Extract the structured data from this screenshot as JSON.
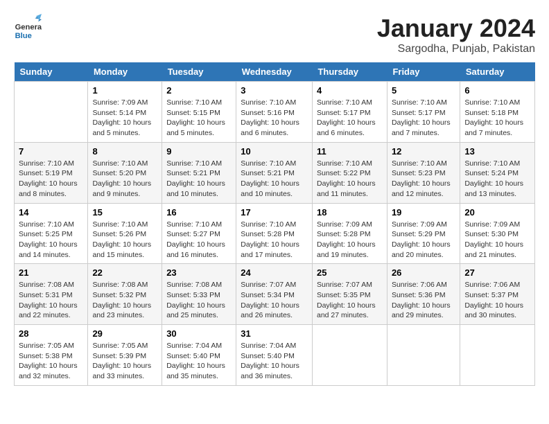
{
  "header": {
    "logo": {
      "general": "General",
      "blue": "Blue"
    },
    "title": "January 2024",
    "location": "Sargodha, Punjab, Pakistan"
  },
  "weekdays": [
    "Sunday",
    "Monday",
    "Tuesday",
    "Wednesday",
    "Thursday",
    "Friday",
    "Saturday"
  ],
  "weeks": [
    [
      {
        "day": "",
        "info": ""
      },
      {
        "day": "1",
        "info": "Sunrise: 7:09 AM\nSunset: 5:14 PM\nDaylight: 10 hours\nand 5 minutes."
      },
      {
        "day": "2",
        "info": "Sunrise: 7:10 AM\nSunset: 5:15 PM\nDaylight: 10 hours\nand 5 minutes."
      },
      {
        "day": "3",
        "info": "Sunrise: 7:10 AM\nSunset: 5:16 PM\nDaylight: 10 hours\nand 6 minutes."
      },
      {
        "day": "4",
        "info": "Sunrise: 7:10 AM\nSunset: 5:17 PM\nDaylight: 10 hours\nand 6 minutes."
      },
      {
        "day": "5",
        "info": "Sunrise: 7:10 AM\nSunset: 5:17 PM\nDaylight: 10 hours\nand 7 minutes."
      },
      {
        "day": "6",
        "info": "Sunrise: 7:10 AM\nSunset: 5:18 PM\nDaylight: 10 hours\nand 7 minutes."
      }
    ],
    [
      {
        "day": "7",
        "info": "Sunrise: 7:10 AM\nSunset: 5:19 PM\nDaylight: 10 hours\nand 8 minutes."
      },
      {
        "day": "8",
        "info": "Sunrise: 7:10 AM\nSunset: 5:20 PM\nDaylight: 10 hours\nand 9 minutes."
      },
      {
        "day": "9",
        "info": "Sunrise: 7:10 AM\nSunset: 5:21 PM\nDaylight: 10 hours\nand 10 minutes."
      },
      {
        "day": "10",
        "info": "Sunrise: 7:10 AM\nSunset: 5:21 PM\nDaylight: 10 hours\nand 10 minutes."
      },
      {
        "day": "11",
        "info": "Sunrise: 7:10 AM\nSunset: 5:22 PM\nDaylight: 10 hours\nand 11 minutes."
      },
      {
        "day": "12",
        "info": "Sunrise: 7:10 AM\nSunset: 5:23 PM\nDaylight: 10 hours\nand 12 minutes."
      },
      {
        "day": "13",
        "info": "Sunrise: 7:10 AM\nSunset: 5:24 PM\nDaylight: 10 hours\nand 13 minutes."
      }
    ],
    [
      {
        "day": "14",
        "info": "Sunrise: 7:10 AM\nSunset: 5:25 PM\nDaylight: 10 hours\nand 14 minutes."
      },
      {
        "day": "15",
        "info": "Sunrise: 7:10 AM\nSunset: 5:26 PM\nDaylight: 10 hours\nand 15 minutes."
      },
      {
        "day": "16",
        "info": "Sunrise: 7:10 AM\nSunset: 5:27 PM\nDaylight: 10 hours\nand 16 minutes."
      },
      {
        "day": "17",
        "info": "Sunrise: 7:10 AM\nSunset: 5:28 PM\nDaylight: 10 hours\nand 17 minutes."
      },
      {
        "day": "18",
        "info": "Sunrise: 7:09 AM\nSunset: 5:28 PM\nDaylight: 10 hours\nand 19 minutes."
      },
      {
        "day": "19",
        "info": "Sunrise: 7:09 AM\nSunset: 5:29 PM\nDaylight: 10 hours\nand 20 minutes."
      },
      {
        "day": "20",
        "info": "Sunrise: 7:09 AM\nSunset: 5:30 PM\nDaylight: 10 hours\nand 21 minutes."
      }
    ],
    [
      {
        "day": "21",
        "info": "Sunrise: 7:08 AM\nSunset: 5:31 PM\nDaylight: 10 hours\nand 22 minutes."
      },
      {
        "day": "22",
        "info": "Sunrise: 7:08 AM\nSunset: 5:32 PM\nDaylight: 10 hours\nand 23 minutes."
      },
      {
        "day": "23",
        "info": "Sunrise: 7:08 AM\nSunset: 5:33 PM\nDaylight: 10 hours\nand 25 minutes."
      },
      {
        "day": "24",
        "info": "Sunrise: 7:07 AM\nSunset: 5:34 PM\nDaylight: 10 hours\nand 26 minutes."
      },
      {
        "day": "25",
        "info": "Sunrise: 7:07 AM\nSunset: 5:35 PM\nDaylight: 10 hours\nand 27 minutes."
      },
      {
        "day": "26",
        "info": "Sunrise: 7:06 AM\nSunset: 5:36 PM\nDaylight: 10 hours\nand 29 minutes."
      },
      {
        "day": "27",
        "info": "Sunrise: 7:06 AM\nSunset: 5:37 PM\nDaylight: 10 hours\nand 30 minutes."
      }
    ],
    [
      {
        "day": "28",
        "info": "Sunrise: 7:05 AM\nSunset: 5:38 PM\nDaylight: 10 hours\nand 32 minutes."
      },
      {
        "day": "29",
        "info": "Sunrise: 7:05 AM\nSunset: 5:39 PM\nDaylight: 10 hours\nand 33 minutes."
      },
      {
        "day": "30",
        "info": "Sunrise: 7:04 AM\nSunset: 5:40 PM\nDaylight: 10 hours\nand 35 minutes."
      },
      {
        "day": "31",
        "info": "Sunrise: 7:04 AM\nSunset: 5:40 PM\nDaylight: 10 hours\nand 36 minutes."
      },
      {
        "day": "",
        "info": ""
      },
      {
        "day": "",
        "info": ""
      },
      {
        "day": "",
        "info": ""
      }
    ]
  ]
}
